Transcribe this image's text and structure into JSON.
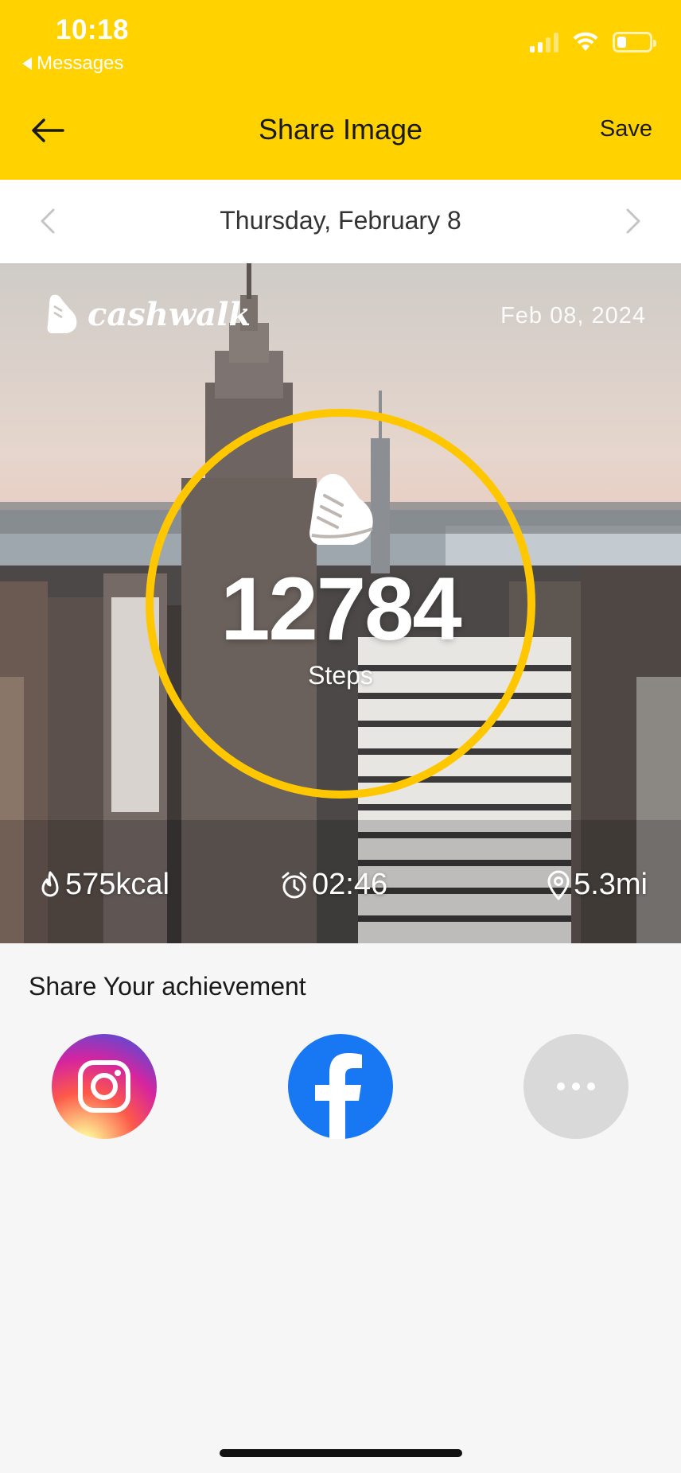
{
  "status_bar": {
    "time": "10:18",
    "back_app_label": "Messages",
    "battery_level": 0.3
  },
  "nav": {
    "title": "Share Image",
    "save_label": "Save"
  },
  "date_selector": {
    "date": "Thursday, February 8"
  },
  "card": {
    "brand": "cashwalk",
    "date": "Feb 08, 2024",
    "steps": "12784",
    "steps_label": "Steps",
    "calories": "575kcal",
    "duration": "02:46",
    "distance": "5.3mi",
    "ring_color": "#ffc700"
  },
  "share": {
    "title": "Share Your achievement",
    "options": [
      "instagram-icon",
      "facebook-icon",
      "more-icon"
    ]
  },
  "theme": {
    "accent": "#ffd200",
    "facebook_blue": "#1877f2"
  }
}
